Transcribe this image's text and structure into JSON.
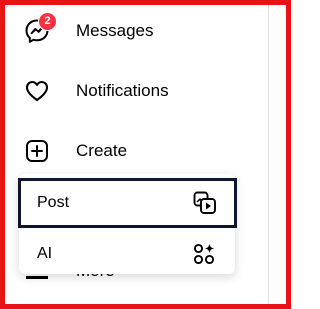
{
  "nav": {
    "messages": {
      "label": "Messages",
      "badge": "2",
      "icon": "messenger-icon"
    },
    "notifications": {
      "label": "Notifications",
      "icon": "heart-icon"
    },
    "create": {
      "label": "Create",
      "icon": "plus-square-icon"
    },
    "more": {
      "label": "More",
      "icon": "menu-icon"
    }
  },
  "create_menu": {
    "items": [
      {
        "label": "Post",
        "icon": "post-media-icon",
        "highlighted": true
      },
      {
        "label": "AI",
        "icon": "ai-sparkle-icon",
        "highlighted": false
      }
    ]
  },
  "colors": {
    "frame": "#e8121b",
    "badge": "#ff3040",
    "highlight_border": "#0d1633"
  }
}
